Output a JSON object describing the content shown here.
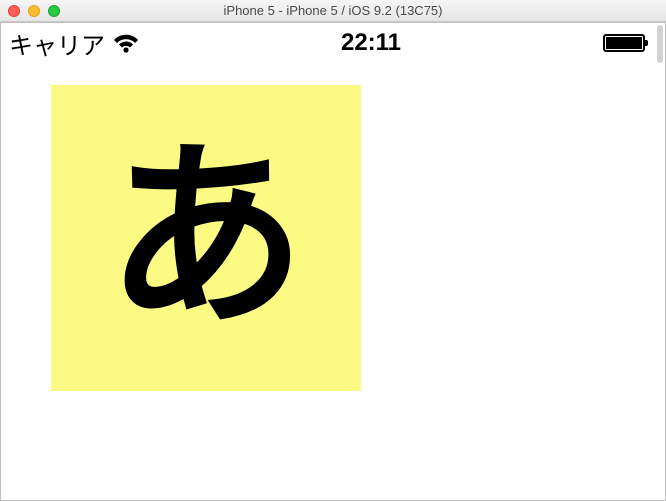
{
  "window": {
    "title": "iPhone 5 - iPhone 5 / iOS 9.2 (13C75)"
  },
  "statusBar": {
    "carrier": "キャリア",
    "time": "22:11"
  },
  "content": {
    "boxColor": "#fbfa83",
    "character": "あ"
  }
}
